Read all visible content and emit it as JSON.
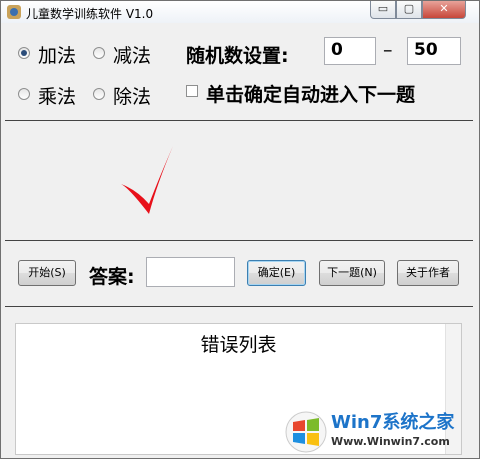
{
  "window": {
    "title": "儿童数学训练软件 V1.0",
    "controls": {
      "minimize": "▭",
      "maximize": "▢",
      "close": "✕"
    }
  },
  "operations": [
    {
      "label": "加法",
      "checked": true
    },
    {
      "label": "减法",
      "checked": false
    },
    {
      "label": "乘法",
      "checked": false
    },
    {
      "label": "除法",
      "checked": false
    }
  ],
  "random_settings": {
    "label": "随机数设置:",
    "min": "0",
    "dash": "–",
    "max": "50"
  },
  "auto_next": {
    "label": "单击确定自动进入下一题",
    "checked": false
  },
  "result": {
    "mark": "check",
    "color": "#e8101a"
  },
  "controls": {
    "start": "开始(S)",
    "answer_label": "答案:",
    "answer_value": "",
    "confirm": "确定(E)",
    "next": "下一题(N)",
    "about": "关于作者"
  },
  "error_list": {
    "title": "错误列表",
    "items": []
  },
  "watermark": {
    "brand": "Win7系统之家",
    "url": "Www.Winwin7.com"
  }
}
